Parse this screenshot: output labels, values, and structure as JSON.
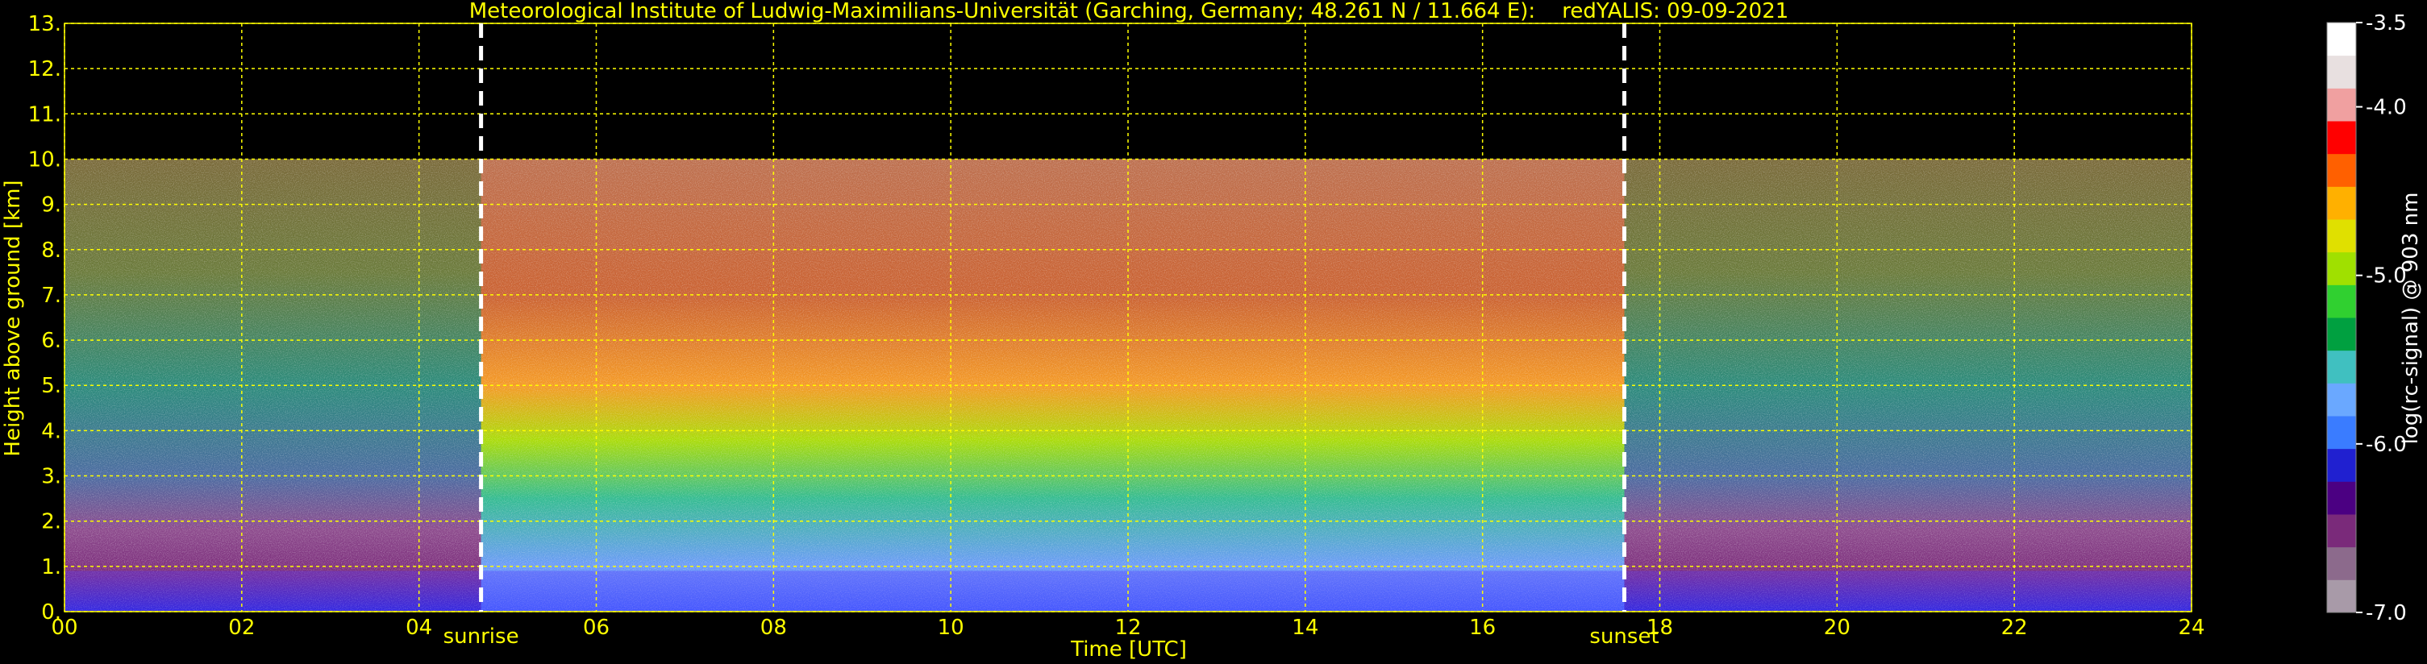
{
  "chart_data": {
    "type": "heatmap",
    "title": "Meteorological Institute of Ludwig-Maximilians-Universität (Garching, Germany; 48.261 N / 11.664 E):    redYALIS: 09-09-2021",
    "xlabel": "Time [UTC]",
    "ylabel": "Height above ground [km]",
    "colorbar_label": "log(rc-signal) @ 903 nm",
    "xlim": [
      0,
      24
    ],
    "ylim": [
      0,
      13
    ],
    "data_top_km": 10,
    "x_ticks": [
      0,
      2,
      4,
      6,
      8,
      10,
      12,
      14,
      16,
      18,
      20,
      22,
      24
    ],
    "x_tick_labels": [
      "00",
      "02",
      "04",
      "06",
      "08",
      "10",
      "12",
      "14",
      "16",
      "18",
      "20",
      "22",
      "24"
    ],
    "y_ticks": [
      0,
      1,
      2,
      3,
      4,
      5,
      6,
      7,
      8,
      9,
      10,
      11,
      12,
      13
    ],
    "y_tick_labels": [
      "0.",
      "1.",
      "2.",
      "3.",
      "4.",
      "5.",
      "6.",
      "7.",
      "8.",
      "9.",
      "10.",
      "11.",
      "12.",
      "13."
    ],
    "colorbar_range": [
      -7.0,
      -3.5
    ],
    "colorbar_ticks": [
      -3.5,
      -4.0,
      -5.0,
      -6.0,
      -7.0
    ],
    "colorbar_tick_labels": [
      "-3.5",
      "-4.0",
      "-5.0",
      "-6.0",
      "-7.0"
    ],
    "colorbar_colors": [
      "#a89aa8",
      "#8c6a8c",
      "#7a2a7a",
      "#4b0082",
      "#2020d0",
      "#3a7cff",
      "#6aa8ff",
      "#40c0c0",
      "#00a040",
      "#30d030",
      "#a0e000",
      "#e0e000",
      "#ffb000",
      "#ff6000",
      "#ff0000",
      "#f0a0a0",
      "#e8e0e0",
      "#ffffff"
    ],
    "events": [
      {
        "label": "sunrise",
        "x": 4.7
      },
      {
        "label": "sunset",
        "x": 17.6
      }
    ],
    "grid": true,
    "grid_color": "#ffff00",
    "text_color": "#ffff00"
  }
}
